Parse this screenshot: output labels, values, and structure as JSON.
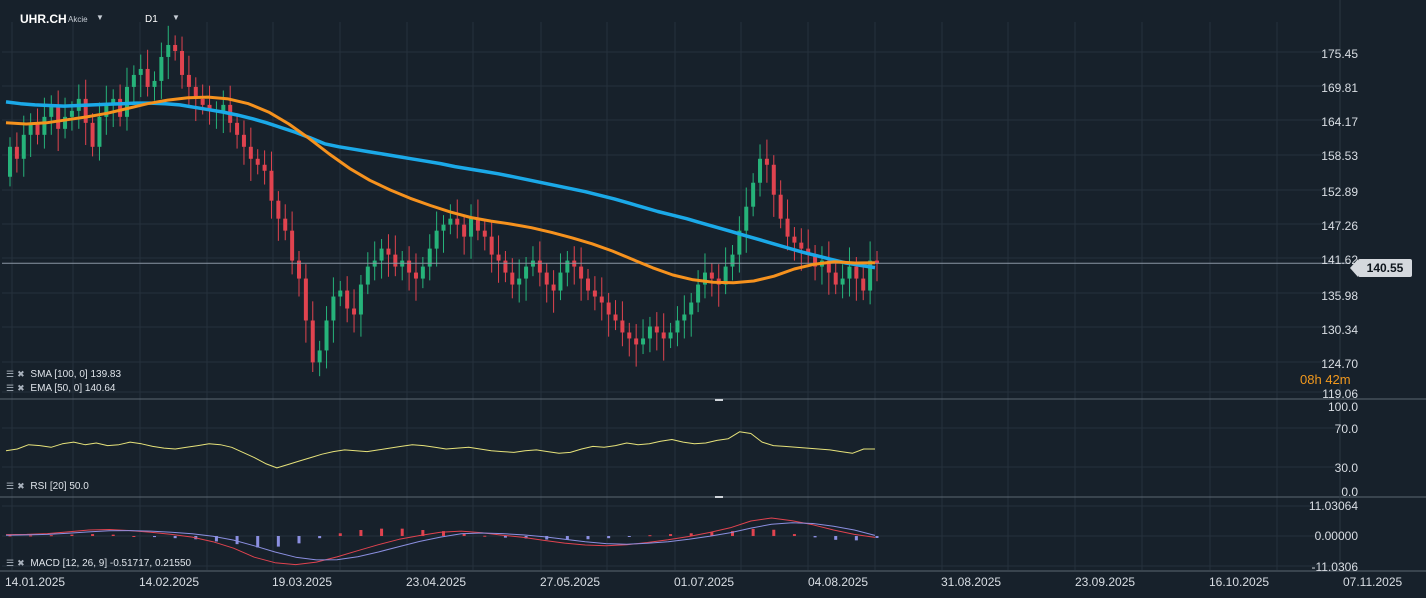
{
  "header": {
    "symbol": "UHR.CH",
    "asset_type": "Akcie",
    "timeframe": "D1"
  },
  "price_axis": {
    "labels": [
      "175.45",
      "169.81",
      "164.17",
      "158.53",
      "152.89",
      "147.26",
      "141.62",
      "135.98",
      "130.34",
      "124.70",
      "119.06"
    ]
  },
  "last_price": "140.55",
  "countdown": {
    "hours": "08",
    "h_unit": "h",
    "minutes": "42",
    "m_unit": "m"
  },
  "indicators": {
    "sma": {
      "label": "SMA [100, 0]",
      "value": "139.83",
      "color": "#1ba9e8"
    },
    "ema": {
      "label": "EMA [50, 0]",
      "value": "140.64",
      "color": "#f6921e"
    },
    "rsi": {
      "label": "RSI [20]",
      "value": "50.0",
      "color": "#e6e27a",
      "axis_labels": [
        "100.0",
        "70.0",
        "30.0",
        "0.0"
      ]
    },
    "macd": {
      "label": "MACD [12, 26, 9]",
      "value1": "-0.51717,",
      "value2": "0.21550",
      "axis_labels": [
        "11.03064",
        "0.00000",
        "-11.0306"
      ]
    }
  },
  "date_axis": {
    "labels": [
      "14.01.2025",
      "14.02.2025",
      "19.03.2025",
      "23.04.2025",
      "27.05.2025",
      "01.07.2025",
      "04.08.2025",
      "31.08.2025",
      "23.09.2025",
      "16.10.2025",
      "07.11.2025"
    ]
  },
  "colors": {
    "up": "#26b37a",
    "down": "#e0434f",
    "background": "#17212b",
    "grid": "#26313c"
  },
  "chart_data": {
    "type": "candlestick",
    "ylim": [
      119.06,
      178.5
    ],
    "series": [
      {
        "name": "UHR.CH",
        "type": "candlestick",
        "x": [
          "14.01.2025",
          "",
          "",
          "",
          "",
          "",
          "",
          "",
          "",
          "",
          "",
          "",
          "",
          "",
          "",
          "",
          "",
          "",
          "",
          "",
          "",
          "",
          "14.02.2025",
          "",
          "",
          "",
          "",
          "",
          "",
          "",
          "",
          "",
          "",
          "",
          "",
          "",
          "",
          "",
          "",
          "",
          "",
          "",
          "",
          "",
          "",
          "",
          "19.03.2025",
          "",
          "",
          "",
          "",
          "",
          "",
          "",
          "",
          "",
          "",
          "",
          "",
          "",
          "",
          "",
          "",
          "",
          "",
          "",
          "",
          "",
          "",
          "",
          "",
          "23.04.2025",
          "",
          "",
          "",
          "",
          "",
          "",
          "",
          "",
          "",
          "",
          "",
          "",
          "",
          "",
          "",
          "",
          "",
          "",
          "",
          "",
          "",
          "",
          "",
          "",
          "27.05.2025",
          "",
          "",
          "",
          "",
          "",
          "",
          "",
          "",
          "",
          "",
          "",
          "",
          "",
          "",
          "",
          "",
          "",
          "",
          "",
          "",
          "",
          "",
          "",
          "",
          "01.07.2025",
          "",
          "",
          "",
          "",
          "",
          "",
          "",
          "",
          "",
          "",
          "",
          "",
          "",
          "",
          "",
          "",
          "",
          "",
          "",
          "",
          "",
          "",
          "",
          "04.08.2025",
          "",
          "",
          "",
          "",
          "",
          "",
          "",
          "",
          "",
          "",
          "",
          "",
          ""
        ],
        "open": [
          155.0,
          160.0,
          158.0,
          162.0,
          164.0,
          162.0,
          165.0,
          167.0,
          163.0,
          165.0,
          166.0,
          168.0,
          164.0,
          160.0,
          165.0,
          167.0,
          168.0,
          165.0,
          170.0,
          172.0,
          173.0,
          170.0,
          171.0,
          175.0,
          177.0,
          176.0,
          172.0,
          170.0,
          168.0,
          167.0,
          166.0,
          166.0,
          167.0,
          164.0,
          162.0,
          160.0,
          158.0,
          157.0,
          156.0,
          151.0,
          148.0,
          146.0,
          141.0,
          138.0,
          131.0,
          124.0,
          126.0,
          131.0,
          135.0,
          136.0,
          133.0,
          132.0,
          137.0,
          140.0,
          141.0,
          143.0,
          142.0,
          140.0,
          141.0,
          139.0,
          138.0,
          140.0,
          143.0,
          146.0,
          147.0,
          148.0,
          147.0,
          145.0,
          148.0,
          146.0,
          145.0,
          142.0,
          141.0,
          139.0,
          137.0,
          138.0,
          140.0,
          141.0,
          139.0,
          137.0,
          136.0,
          139.0,
          141.0,
          140.0,
          138.0,
          136.0,
          135.0,
          134.0,
          132.0,
          131.0,
          129.0,
          128.0,
          127.0,
          128.0,
          130.0,
          129.0,
          128.0,
          129.0,
          131.0,
          132.0,
          134.0,
          137.0,
          139.0,
          138.0,
          137.0,
          140.0,
          142.0,
          146.0,
          150.0,
          154.0,
          158.0,
          157.0,
          152.0,
          148.0,
          145.0,
          144.0,
          143.0,
          142.0,
          140.0,
          141.0,
          139.0,
          137.0,
          138.0,
          140.0,
          138.0,
          136.0,
          141.0
        ],
        "close": [
          160.0,
          158.0,
          162.0,
          164.0,
          162.0,
          165.0,
          167.0,
          163.0,
          165.0,
          166.0,
          168.0,
          164.0,
          160.0,
          165.0,
          167.0,
          168.0,
          165.0,
          170.0,
          172.0,
          173.0,
          170.0,
          171.0,
          175.0,
          177.0,
          176.0,
          172.0,
          170.0,
          168.0,
          167.0,
          166.0,
          166.0,
          167.0,
          164.0,
          162.0,
          160.0,
          158.0,
          157.0,
          156.0,
          151.0,
          148.0,
          146.0,
          141.0,
          138.0,
          131.0,
          124.0,
          126.0,
          131.0,
          135.0,
          136.0,
          133.0,
          132.0,
          137.0,
          140.0,
          141.0,
          143.0,
          142.0,
          140.0,
          141.0,
          139.0,
          138.0,
          140.0,
          143.0,
          146.0,
          147.0,
          148.0,
          147.0,
          145.0,
          148.0,
          146.0,
          145.0,
          142.0,
          141.0,
          139.0,
          137.0,
          138.0,
          140.0,
          141.0,
          139.0,
          137.0,
          136.0,
          139.0,
          141.0,
          140.0,
          138.0,
          136.0,
          135.0,
          134.0,
          132.0,
          131.0,
          129.0,
          128.0,
          127.0,
          128.0,
          130.0,
          129.0,
          128.0,
          129.0,
          131.0,
          132.0,
          134.0,
          137.0,
          139.0,
          138.0,
          137.0,
          140.0,
          142.0,
          146.0,
          150.0,
          154.0,
          158.0,
          157.0,
          152.0,
          148.0,
          145.0,
          144.0,
          143.0,
          142.0,
          140.0,
          141.0,
          139.0,
          137.0,
          138.0,
          140.0,
          138.0,
          136.0,
          141.0,
          140.55
        ]
      },
      {
        "name": "SMA [100, 0]",
        "type": "line",
        "values": [
          167.5,
          167.2,
          167.0,
          166.9,
          166.8,
          166.9,
          167.0,
          167.1,
          167.2,
          167.3,
          167.3,
          167.2,
          167.0,
          166.6,
          166.2,
          165.8,
          165.3,
          164.7,
          164.0,
          163.2,
          162.4,
          161.5,
          160.5,
          160.0,
          159.6,
          159.2,
          158.8,
          158.4,
          158.0,
          157.6,
          157.2,
          156.7,
          156.3,
          155.9,
          155.5,
          155.0,
          154.5,
          154.0,
          153.5,
          153.0,
          152.5,
          151.9,
          151.3,
          150.6,
          149.9,
          149.2,
          148.6,
          148.0,
          147.3,
          146.6,
          145.9,
          145.2,
          144.5,
          143.8,
          143.1,
          142.4,
          141.8,
          141.2,
          140.6,
          140.2,
          139.83
        ]
      },
      {
        "name": "EMA [50, 0]",
        "type": "line",
        "values": [
          164.0,
          163.8,
          164.0,
          164.5,
          165.0,
          165.6,
          166.4,
          167.2,
          167.8,
          168.2,
          168.3,
          168.0,
          167.2,
          165.8,
          163.8,
          161.4,
          158.8,
          156.4,
          154.4,
          152.8,
          151.4,
          150.2,
          149.1,
          148.2,
          147.6,
          147.1,
          146.5,
          145.7,
          144.8,
          143.8,
          142.6,
          141.2,
          139.8,
          138.6,
          137.8,
          137.4,
          137.3,
          137.6,
          138.4,
          139.6,
          140.4,
          140.8,
          140.6,
          140.64
        ]
      },
      {
        "name": "RSI [20]",
        "type": "line",
        "values": [
          48,
          50,
          55,
          54,
          52,
          56,
          58,
          55,
          57,
          54,
          55,
          58,
          56,
          53,
          51,
          50,
          52,
          54,
          56,
          55,
          52,
          46,
          40,
          33,
          28,
          32,
          36,
          40,
          44,
          47,
          49,
          48,
          47,
          49,
          51,
          53,
          55,
          54,
          52,
          50,
          51,
          52,
          50,
          48,
          47,
          46,
          48,
          49,
          47,
          45,
          46,
          50,
          53,
          52,
          54,
          57,
          55,
          56,
          59,
          61,
          58,
          56,
          57,
          60,
          62,
          70,
          68,
          58,
          54,
          53,
          52,
          51,
          50,
          49,
          47,
          45,
          50,
          50.0
        ]
      },
      {
        "name": "MACD [12, 26, 9]",
        "type": "line",
        "values": [
          0.5,
          0.6,
          0.9,
          1.5,
          2.2,
          2.4,
          2.0,
          1.4,
          0.6,
          -0.4,
          -2.1,
          -4.5,
          -7.8,
          -9.8,
          -10.5,
          -9.6,
          -7.7,
          -5.4,
          -3.2,
          -1.2,
          0.2,
          1.4,
          1.8,
          1.2,
          0.3,
          -0.5,
          -1.6,
          -2.6,
          -3.3,
          -3.6,
          -3.2,
          -2.4,
          -1.4,
          -0.2,
          1.3,
          3.0,
          5.5,
          6.6,
          5.6,
          4.1,
          2.2,
          0.6,
          -0.51717
        ]
      },
      {
        "name": "Signal",
        "type": "line",
        "values": [
          0.3,
          0.4,
          0.6,
          1.0,
          1.5,
          1.9,
          2.0,
          1.8,
          1.4,
          0.8,
          -0.1,
          -1.5,
          -3.6,
          -5.9,
          -7.8,
          -8.8,
          -8.7,
          -7.6,
          -5.9,
          -3.9,
          -2.0,
          -0.4,
          0.8,
          1.1,
          0.9,
          0.4,
          -0.3,
          -1.2,
          -2.1,
          -2.8,
          -3.0,
          -2.7,
          -2.1,
          -1.2,
          -0.1,
          1.2,
          2.9,
          4.3,
          4.9,
          4.6,
          3.6,
          2.2,
          0.2155
        ]
      },
      {
        "name": "Histogram",
        "type": "bar",
        "values": [
          0.2,
          0.2,
          0.3,
          0.5,
          0.7,
          0.5,
          0.0,
          -0.4,
          -0.8,
          -1.2,
          -2.0,
          -3.0,
          -4.2,
          -3.9,
          -2.7,
          -0.8,
          1.0,
          2.2,
          2.7,
          2.7,
          2.2,
          1.8,
          1.0,
          0.1,
          -0.6,
          -0.9,
          -1.3,
          -1.4,
          -1.2,
          -0.8,
          -0.2,
          0.3,
          0.7,
          1.0,
          1.4,
          1.8,
          2.6,
          2.3,
          0.7,
          -0.5,
          -1.4,
          -1.6,
          -0.73
        ]
      }
    ],
    "macd_ylim": [
      -11.0306,
      11.03064
    ],
    "rsi_ylim": [
      0,
      100
    ],
    "grid": true,
    "legend_placement": "bottom-left"
  }
}
